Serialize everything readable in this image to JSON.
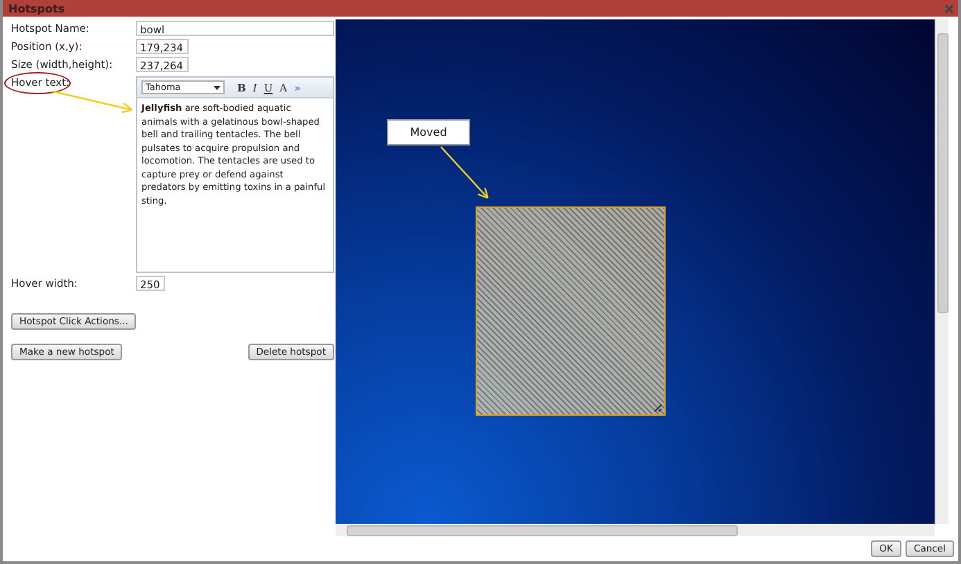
{
  "window": {
    "title": "Hotspots"
  },
  "fields": [
    {
      "label": "Hotspot Name:",
      "value": "bowl",
      "kind": "wide"
    },
    {
      "label": "Position (x,y):",
      "value": "179,234",
      "kind": "short"
    },
    {
      "label": "Size (width,height):",
      "value": "237,264",
      "kind": "short"
    }
  ],
  "hover_text": {
    "label": "Hover text:",
    "font": "Tahoma",
    "tools": [
      "B",
      "I",
      "U",
      "A",
      "»"
    ],
    "content": "**Jellyfish** are soft-bodied aquatic animals with a gelatinous bowl-shaped bell and trailing tentacles. The bell pulsates to acquire propulsion and locomotion. The tentacles are used to capture prey or defend against predators by emitting toxins in a painful sting."
  },
  "hover_width": {
    "label": "Hover width:",
    "value": "250"
  },
  "actions_button": "Hotspot Click Actions...",
  "new_button": "Make a new hotspot",
  "delete_button": "Delete hotspot",
  "annotation": {
    "callout": "Moved"
  },
  "footer_buttons": [
    "OK",
    "Cancel"
  ]
}
